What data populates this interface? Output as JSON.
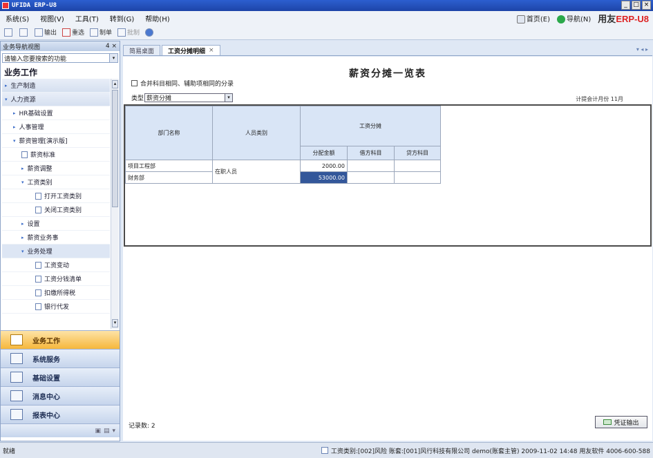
{
  "window": {
    "title": "UFIDA ERP-U8"
  },
  "menu": [
    "系统(S)",
    "视图(V)",
    "工具(T)",
    "转到(G)",
    "帮助(H)"
  ],
  "topright": {
    "home": "首页(E)",
    "nav": "导航(N)",
    "brand_a": "用友",
    "brand_b": "ERP-U8"
  },
  "toolbar": [
    {
      "label": "",
      "icon": "print-icon"
    },
    {
      "label": "",
      "icon": "preview-icon"
    },
    {
      "label": "输出",
      "icon": "export-icon"
    },
    {
      "label": "重选",
      "icon": "reselect-icon"
    },
    {
      "label": "制单",
      "icon": "voucher-icon"
    },
    {
      "label": "批制",
      "icon": "batch-icon",
      "disabled": true
    },
    {
      "label": "",
      "icon": "help-icon"
    }
  ],
  "nav": {
    "header": "业务导航视图",
    "header_ctl": "4 ×",
    "search_placeholder": "请输入您要搜索的功能",
    "section_title": "业务工作",
    "tree": [
      {
        "label": "生产制造",
        "level": 0,
        "arrow": "▸"
      },
      {
        "label": "人力资源",
        "level": 0,
        "arrow": "▾"
      },
      {
        "label": "HR基础设置",
        "level": 1,
        "arrow": "▸"
      },
      {
        "label": "人事管理",
        "level": 1,
        "arrow": "▸"
      },
      {
        "label": "薪资管理[演示版]",
        "level": 1,
        "arrow": "▾"
      },
      {
        "label": "薪资标准",
        "level": 2,
        "doc": true
      },
      {
        "label": "薪资调整",
        "level": 2,
        "arrow": "▸"
      },
      {
        "label": "工资类别",
        "level": 2,
        "arrow": "▾"
      },
      {
        "label": "打开工资类别",
        "level": 3,
        "doc": true
      },
      {
        "label": "关闭工资类别",
        "level": 3,
        "doc": true
      },
      {
        "label": "设置",
        "level": 2,
        "arrow": "▸"
      },
      {
        "label": "薪资业务事",
        "level": 2,
        "arrow": "▸"
      },
      {
        "label": "业务处理",
        "level": 2,
        "arrow": "▾",
        "selected": true
      },
      {
        "label": "工资变动",
        "level": 3,
        "doc": true
      },
      {
        "label": "工资分钱清单",
        "level": 3,
        "doc": true
      },
      {
        "label": "扣缴所得税",
        "level": 3,
        "doc": true
      },
      {
        "label": "银行代发",
        "level": 3,
        "doc": true
      }
    ],
    "big_buttons": [
      {
        "label": "业务工作",
        "active": true,
        "icon": "business-icon"
      },
      {
        "label": "系统服务",
        "icon": "system-service-icon"
      },
      {
        "label": "基础设置",
        "icon": "basic-settings-icon"
      },
      {
        "label": "消息中心",
        "icon": "message-center-icon"
      },
      {
        "label": "报表中心",
        "icon": "report-center-icon"
      }
    ]
  },
  "tabs": [
    {
      "label": "简易桌面",
      "active": false
    },
    {
      "label": "工资分摊明细",
      "active": true,
      "close": "×"
    }
  ],
  "tabnav": "▾ ◂ ▸",
  "report": {
    "title": "薪资分摊一览表",
    "merge_label": "合并科目相同、辅助项相同的分录",
    "type_label": "类型",
    "type_value": "薪资分摊",
    "period": "计提会计月份    11月",
    "headers": {
      "dept": "部门名称",
      "person": "人员类别",
      "group": "工资分摊",
      "amount": "分配金额",
      "debit": "借方科目",
      "credit": "贷方科目"
    },
    "rows": [
      {
        "dept": "项目工程部",
        "person": "在职人员",
        "amount": "2000.00",
        "debit": "",
        "credit": ""
      },
      {
        "dept": "财务部",
        "person": "在职人员",
        "amount": "53000.00",
        "debit": "",
        "credit": ""
      }
    ],
    "record_count": "记录数: 2",
    "output_button": "凭证输出"
  },
  "status": {
    "left": "就绪",
    "right": "工资类别:[002]风险  账套:[001]风行科技有限公司  demo(账套主管)  2009-11-02 14:48  用友软件  4006-600-588"
  }
}
